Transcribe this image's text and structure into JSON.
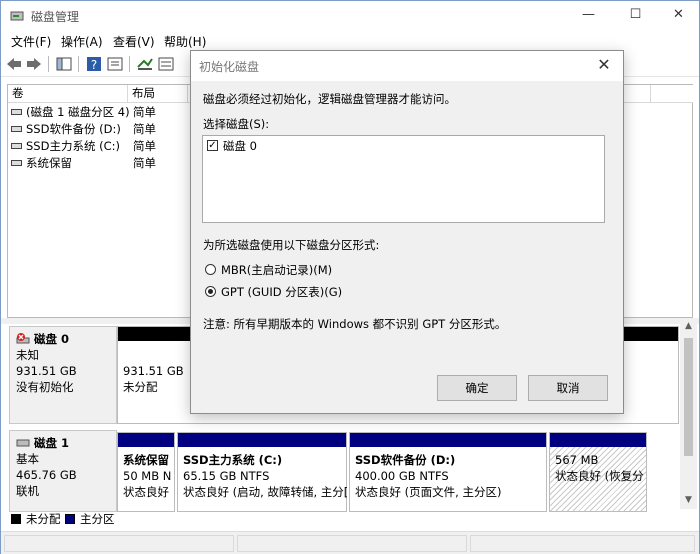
{
  "window": {
    "title": "磁盘管理",
    "minimize": "—",
    "maximize": "☐",
    "close": "✕"
  },
  "menu": [
    "文件(F)",
    "操作(A)",
    "查看(V)",
    "帮助(H)"
  ],
  "toolbar": {
    "icons": [
      "back-icon",
      "forward-icon",
      "show-hide-icon",
      "help-icon",
      "properties-icon",
      "connect-icon",
      "list-icon"
    ]
  },
  "volume_list": {
    "columns": [
      "卷",
      "布局"
    ],
    "rows": [
      {
        "name": "(磁盘 1 磁盘分区 4)",
        "layout": "简单"
      },
      {
        "name": "SSD软件备份 (D:)",
        "layout": "简单"
      },
      {
        "name": "SSD主力系统 (C:)",
        "layout": "简单"
      },
      {
        "name": "系统保留",
        "layout": "简单"
      }
    ]
  },
  "disks": [
    {
      "title": "磁盘 0",
      "type": "未知",
      "size": "931.51 GB",
      "status": "没有初始化",
      "partitions": [
        {
          "line1": "931.51 GB",
          "line2": "未分配",
          "line3": ""
        }
      ]
    },
    {
      "title": "磁盘 1",
      "type": "基本",
      "size": "465.76 GB",
      "status": "联机",
      "partitions": [
        {
          "line1": "系统保留",
          "line2": "50 MB N",
          "line3": "状态良好"
        },
        {
          "line1": "SSD主力系统  (C:)",
          "line2": "65.15 GB NTFS",
          "line3": "状态良好 (启动, 故障转储, 主分["
        },
        {
          "line1": "SSD软件备份  (D:)",
          "line2": "400.00 GB NTFS",
          "line3": "状态良好 (页面文件, 主分区)"
        },
        {
          "line1": "",
          "line2": "567 MB",
          "line3": "状态良好 (恢复分"
        }
      ]
    }
  ],
  "legend": [
    {
      "label": "未分配",
      "color": "#000000"
    },
    {
      "label": "主分区",
      "color": "#000080"
    }
  ],
  "dialog": {
    "title": "初始化磁盘",
    "intro": "磁盘必须经过初始化，逻辑磁盘管理器才能访问。",
    "select_label": "选择磁盘(S):",
    "disk_item": "磁盘 0",
    "disk_item_checked": true,
    "style_label": "为所选磁盘使用以下磁盘分区形式:",
    "options": [
      {
        "label": "MBR(主启动记录)(M)",
        "selected": false
      },
      {
        "label": "GPT (GUID 分区表)(G)",
        "selected": true
      }
    ],
    "note": "注意: 所有早期版本的 Windows 都不识别 GPT 分区形式。",
    "ok": "确定",
    "cancel": "取消"
  },
  "colors": {
    "primary_partition": "#000080",
    "unallocated": "#000000",
    "dialog_bg": "#f0f0f0"
  }
}
